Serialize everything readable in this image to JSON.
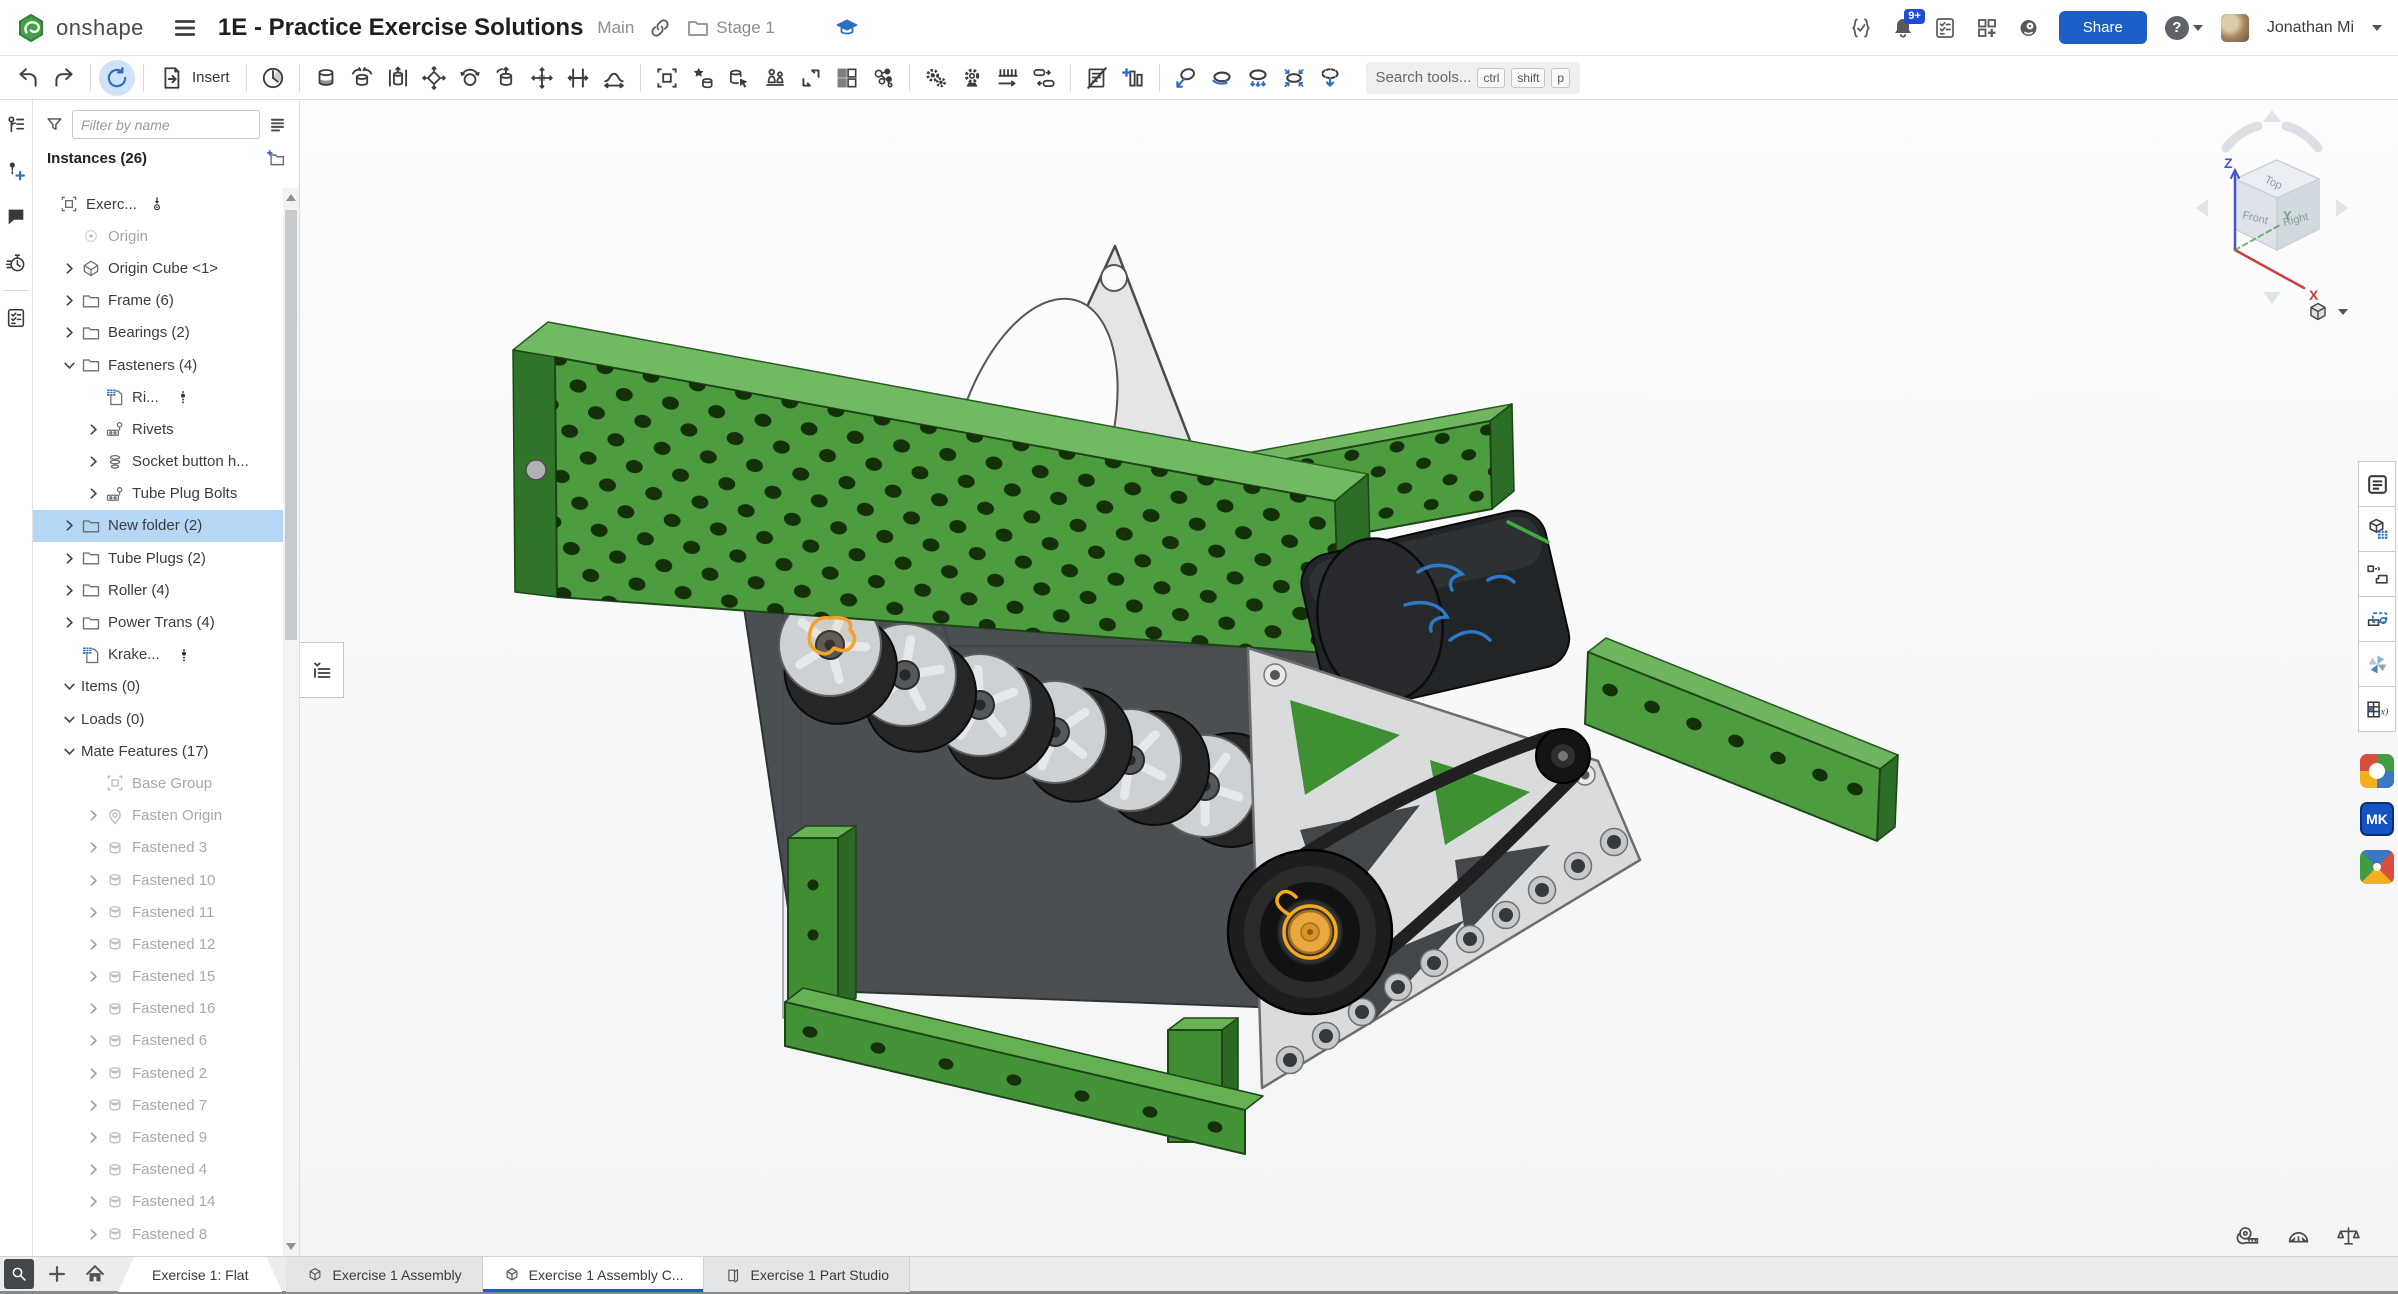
{
  "topbar": {
    "brand": "onshape",
    "title": "1E - Practice Exercise Solutions",
    "version": "Main",
    "workspace": "Stage 1",
    "notification_badge": "9+",
    "share_label": "Share",
    "help_label": "?",
    "user_name": "Jonathan Mi",
    "left_icons": [
      "onshape-logo",
      "hamburger",
      "link",
      "folder",
      "graduation-cap"
    ],
    "right_icons": [
      "code-check",
      "notifications-bell",
      "task-list",
      "apps-plus",
      "ai-assistant"
    ]
  },
  "toolbar": {
    "sections": [
      [
        {
          "icon": "undo"
        },
        {
          "icon": "redo"
        }
      ],
      [
        {
          "icon": "sync-rotate",
          "active": true
        }
      ],
      [
        {
          "icon": "insert-document",
          "label": "Insert"
        }
      ],
      [
        {
          "icon": "mate-clock"
        }
      ],
      [
        {
          "icon": "fastened-mate"
        },
        {
          "icon": "revolute-mate"
        },
        {
          "icon": "slider-mate"
        },
        {
          "icon": "planar-mate"
        },
        {
          "icon": "ball-mate"
        },
        {
          "icon": "cylindrical-mate"
        },
        {
          "icon": "pin-slot-mate"
        },
        {
          "icon": "parallel-mate"
        },
        {
          "icon": "tangent-mate"
        }
      ],
      [
        {
          "icon": "group-mate"
        },
        {
          "icon": "mate-connector"
        },
        {
          "icon": "replace-instance"
        },
        {
          "icon": "named-positions"
        },
        {
          "icon": "snap-mode"
        },
        {
          "icon": "pattern-grid"
        },
        {
          "icon": "exploded-view"
        }
      ],
      [
        {
          "icon": "gear-relation"
        },
        {
          "icon": "gear-detail"
        },
        {
          "icon": "rack-pinion"
        },
        {
          "icon": "screw-relation"
        }
      ],
      [
        {
          "icon": "bom-hidden"
        },
        {
          "icon": "add-column"
        }
      ],
      [
        {
          "icon": "rotate-lasso"
        },
        {
          "icon": "orbit-spin"
        },
        {
          "icon": "orbit-press"
        },
        {
          "icon": "orbit-pinch"
        },
        {
          "icon": "orbit-drop"
        }
      ]
    ],
    "search": {
      "placeholder": "Search tools...",
      "keys": [
        "ctrl",
        "shift",
        "p"
      ]
    }
  },
  "left_rail": {
    "icons": [
      {
        "icon": "structure"
      },
      {
        "icon": "insert-entity"
      },
      {
        "icon": "comments"
      },
      {
        "icon": "history"
      },
      {
        "icon": "follow-checklist",
        "sep": true
      }
    ]
  },
  "instances_panel": {
    "filter_placeholder": "Filter by name",
    "filter_icon": "funnel",
    "view_icon": "list-view",
    "header": "Instances (26)",
    "add_folder_icon": "folder-plus",
    "tree": [
      {
        "level": 0,
        "icon": "t-root",
        "label": "Exerc...",
        "anchor": true
      },
      {
        "level": 1,
        "exp": "",
        "icon": "t-origin",
        "label": "Origin",
        "state": "gray"
      },
      {
        "level": 1,
        "exp": "right",
        "icon": "t-part",
        "label": "Origin Cube <1>"
      },
      {
        "level": 1,
        "exp": "right",
        "icon": "t-folder",
        "label": "Frame (6)"
      },
      {
        "level": 1,
        "exp": "right",
        "icon": "t-folder",
        "label": "Bearings (2)"
      },
      {
        "level": 1,
        "exp": "down",
        "icon": "t-folder",
        "label": "Fasteners (4)"
      },
      {
        "level": 2,
        "exp": "",
        "icon": "t-pattern",
        "label": "Ri...",
        "dots": true
      },
      {
        "level": 2,
        "exp": "right",
        "icon": "t-rivets",
        "label": "Rivets"
      },
      {
        "level": 2,
        "exp": "right",
        "icon": "t-socket",
        "label": "Socket button h..."
      },
      {
        "level": 2,
        "exp": "right",
        "icon": "t-rivets",
        "label": "Tube Plug Bolts"
      },
      {
        "level": 1,
        "exp": "right",
        "icon": "t-folder",
        "label": "New folder (2)",
        "state": "selected"
      },
      {
        "level": 1,
        "exp": "right",
        "icon": "t-folder",
        "label": "Tube Plugs (2)"
      },
      {
        "level": 1,
        "exp": "right",
        "icon": "t-folder",
        "label": "Roller (4)"
      },
      {
        "level": 1,
        "exp": "right",
        "icon": "t-folder",
        "label": "Power Trans (4)"
      },
      {
        "level": 1,
        "exp": "",
        "icon": "t-pattern",
        "label": "Krake...",
        "dots": true
      },
      {
        "level": 0,
        "exp": "down",
        "label": "Items (0)",
        "state": "section"
      },
      {
        "level": 0,
        "exp": "down",
        "label": "Loads (0)",
        "state": "section"
      },
      {
        "level": 0,
        "exp": "down",
        "label": "Mate Features (17)",
        "state": "section"
      },
      {
        "level": 2,
        "exp": "",
        "icon": "t-mategroup",
        "label": "Base Group",
        "state": "gray"
      },
      {
        "level": 2,
        "exp": "right",
        "icon": "t-pin",
        "label": "Fasten Origin",
        "state": "gray"
      },
      {
        "level": 2,
        "exp": "right",
        "icon": "t-mate",
        "label": "Fastened 3",
        "state": "gray"
      },
      {
        "level": 2,
        "exp": "right",
        "icon": "t-mate",
        "label": "Fastened 10",
        "state": "gray"
      },
      {
        "level": 2,
        "exp": "right",
        "icon": "t-mate",
        "label": "Fastened 11",
        "state": "gray"
      },
      {
        "level": 2,
        "exp": "right",
        "icon": "t-mate",
        "label": "Fastened 12",
        "state": "gray"
      },
      {
        "level": 2,
        "exp": "right",
        "icon": "t-mate",
        "label": "Fastened 15",
        "state": "gray"
      },
      {
        "level": 2,
        "exp": "right",
        "icon": "t-mate",
        "label": "Fastened 16",
        "state": "gray"
      },
      {
        "level": 2,
        "exp": "right",
        "icon": "t-mate",
        "label": "Fastened 6",
        "state": "gray"
      },
      {
        "level": 2,
        "exp": "right",
        "icon": "t-mate",
        "label": "Fastened 2",
        "state": "gray"
      },
      {
        "level": 2,
        "exp": "right",
        "icon": "t-mate",
        "label": "Fastened 7",
        "state": "gray"
      },
      {
        "level": 2,
        "exp": "right",
        "icon": "t-mate",
        "label": "Fastened 9",
        "state": "gray"
      },
      {
        "level": 2,
        "exp": "right",
        "icon": "t-mate",
        "label": "Fastened 4",
        "state": "gray"
      },
      {
        "level": 2,
        "exp": "right",
        "icon": "t-mate",
        "label": "Fastened 14",
        "state": "gray"
      },
      {
        "level": 2,
        "exp": "right",
        "icon": "t-mate",
        "label": "Fastened 8",
        "state": "gray"
      }
    ]
  },
  "viewport": {
    "view_cube": {
      "top": "Top",
      "front": "Front",
      "right": "Right",
      "axis_x": "X",
      "axis_y": "Y",
      "axis_z": "Z"
    },
    "measure_icons": [
      "tape-measure",
      "protractor",
      "mass-scale"
    ],
    "selection_color": "#f2a33c"
  },
  "right_rail": {
    "panels": [
      "configurations",
      "bom-cube",
      "assign-part",
      "in-context",
      "pinwheel",
      "custom-table"
    ],
    "apps": [
      {
        "kind": "ring-app"
      },
      {
        "kind": "mk-app",
        "label": "MK"
      },
      {
        "kind": "pin-app"
      }
    ]
  },
  "tabs": {
    "left_icons": [
      "search-tabs",
      "add-tab",
      "home"
    ],
    "items": [
      {
        "label": "Exercise 1: Flat",
        "kind": "flag"
      },
      {
        "label": "Exercise 1 Assembly",
        "kind": "assembly"
      },
      {
        "label": "Exercise 1 Assembly C...",
        "kind": "assembly",
        "active": true
      },
      {
        "label": "Exercise 1 Part Studio",
        "kind": "partstudio"
      }
    ]
  },
  "colors": {
    "accent_blue": "#1b5ec6",
    "selection_blue": "#b5d7f5",
    "part_green": "#4e9c40",
    "highlight_orange": "#f2a33c"
  }
}
